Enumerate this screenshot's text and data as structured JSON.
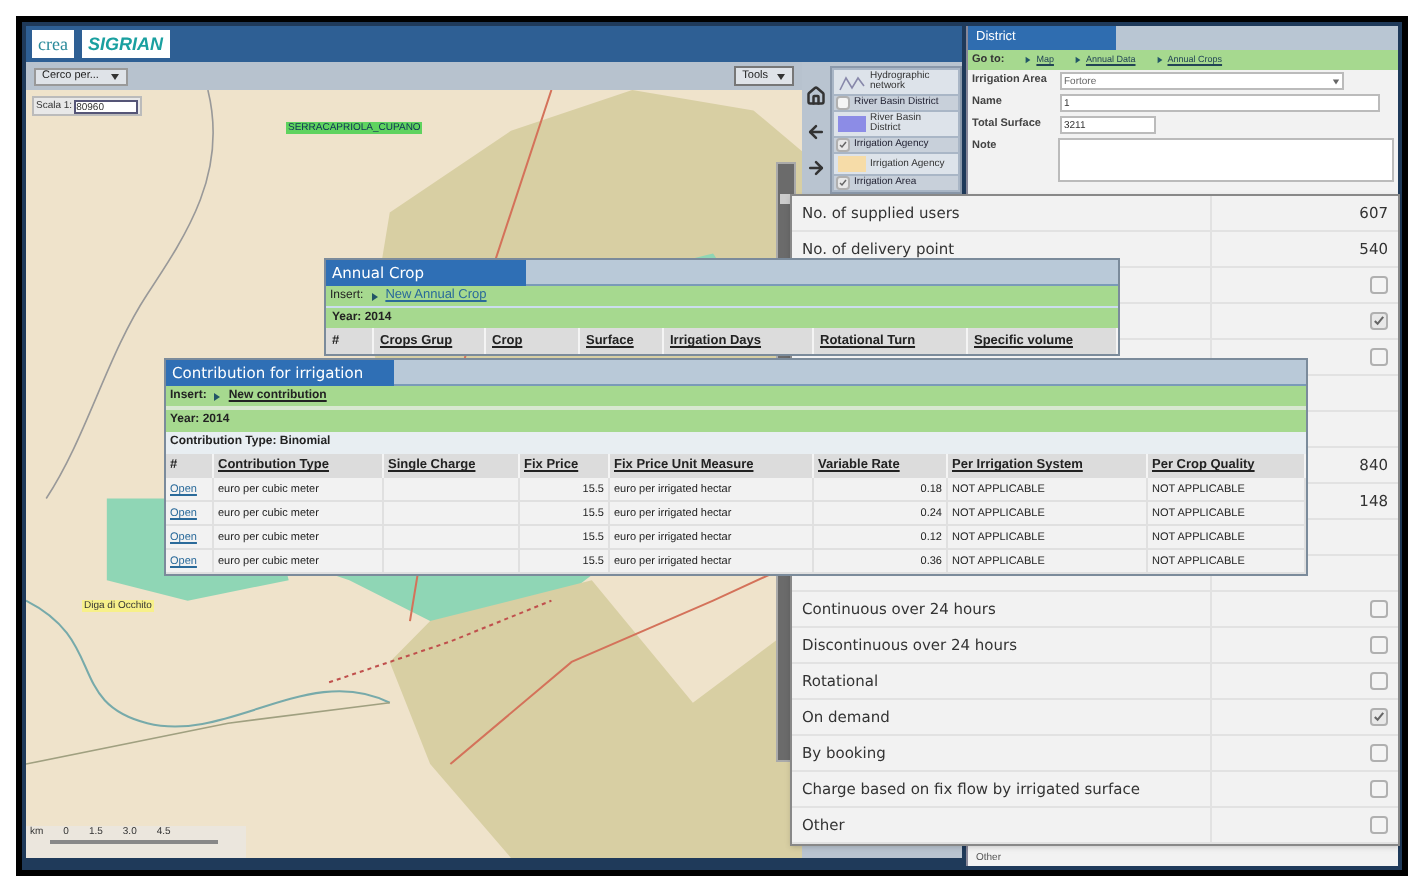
{
  "header": {
    "logos": [
      "crea",
      "SIGRIAN"
    ]
  },
  "map": {
    "search_dropdown": "Cerco per...",
    "tools_button": "Tools",
    "scale_label": "Scala 1:",
    "scale_value": "80960",
    "place_labels": [
      "SERRACAPRIOLA_CUPANO",
      "Diga di Occhito"
    ],
    "scale_bar": {
      "unit": "km",
      "ticks": [
        "0",
        "1.5",
        "3.0",
        "4.5"
      ]
    },
    "zoom": {
      "level": 0.95
    }
  },
  "layers": [
    {
      "kind": "wave-legend",
      "label": "Hydrographic network"
    },
    {
      "kind": "check",
      "label": "River Basin District",
      "checked": false
    },
    {
      "kind": "legend",
      "label": "River Basin District",
      "color": "#8c8ce6"
    },
    {
      "kind": "check",
      "label": "Irrigation Agency",
      "checked": true
    },
    {
      "kind": "legend",
      "label": "Irrigation Agency",
      "color": "#f6dca8"
    },
    {
      "kind": "check",
      "label": "Irrigation Area",
      "checked": true
    }
  ],
  "district": {
    "tab": "District",
    "goto_label": "Go to:",
    "links": [
      "Map",
      "Annual Data",
      "Annual Crops"
    ],
    "fields": [
      {
        "kind": "select",
        "label": "Irrigation Area",
        "value": "Fortore"
      },
      {
        "kind": "text",
        "label": "Name",
        "value": "1"
      },
      {
        "kind": "text",
        "label": "Total Surface",
        "value": "3211"
      },
      {
        "kind": "textarea",
        "label": "Note"
      }
    ],
    "peek_row": "Other"
  },
  "details": [
    {
      "kind": "value",
      "label": "No. of supplied users",
      "value": "607"
    },
    {
      "kind": "value",
      "label": "No. of delivery point",
      "value": "540"
    },
    {
      "kind": "check",
      "checked": false
    },
    {
      "kind": "check",
      "checked": true
    },
    {
      "kind": "check",
      "checked": false
    },
    {
      "kind": "blank"
    },
    {
      "kind": "blank"
    },
    {
      "kind": "value",
      "value": "840"
    },
    {
      "kind": "value",
      "value": "148"
    },
    {
      "kind": "blank"
    },
    {
      "kind": "blank"
    },
    {
      "kind": "check",
      "label": "Continuous over 24 hours",
      "checked": false
    },
    {
      "kind": "check",
      "label": "Discontinuous over 24 hours",
      "checked": false
    },
    {
      "kind": "check",
      "label": "Rotational",
      "checked": false
    },
    {
      "kind": "check",
      "label": "On demand",
      "checked": true
    },
    {
      "kind": "check",
      "label": "By booking",
      "checked": false
    },
    {
      "kind": "check",
      "label": "Charge based on fix flow by irrigated surface",
      "checked": false
    },
    {
      "kind": "check",
      "label": "Other",
      "checked": false
    }
  ],
  "annual_crop": {
    "title": "Annual Crop",
    "insert_label": "Insert:",
    "insert_link": "New Annual Crop",
    "year": "Year: 2014",
    "columns": [
      "#",
      "Crops Grup",
      "Crop",
      "Surface",
      "Irrigation Days",
      "Rotational Turn",
      "Specific volume"
    ]
  },
  "contribution": {
    "title": "Contribution for irrigation",
    "insert_label": "Insert:",
    "insert_link": "New contribution",
    "year": "Year: 2014",
    "type": "Contribution Type: Binomial",
    "columns": [
      "#",
      "Contribution Type",
      "Single Charge",
      "Fix Price",
      "Fix Price Unit Measure",
      "Variable Rate",
      "Per Irrigation System",
      "Per Crop Quality"
    ],
    "rows": [
      [
        "Open",
        "euro per cubic meter",
        "",
        "15.5",
        "euro per irrigated hectar",
        "0.18",
        "NOT APPLICABLE",
        "NOT APPLICABLE"
      ],
      [
        "Open",
        "euro per cubic meter",
        "",
        "15.5",
        "euro per irrigated hectar",
        "0.24",
        "NOT APPLICABLE",
        "NOT APPLICABLE"
      ],
      [
        "Open",
        "euro per cubic meter",
        "",
        "15.5",
        "euro per irrigated hectar",
        "0.12",
        "NOT APPLICABLE",
        "NOT APPLICABLE"
      ],
      [
        "Open",
        "euro per cubic meter",
        "",
        "15.5",
        "euro per irrigated hectar",
        "0.36",
        "NOT APPLICABLE",
        "NOT APPLICABLE"
      ]
    ]
  }
}
